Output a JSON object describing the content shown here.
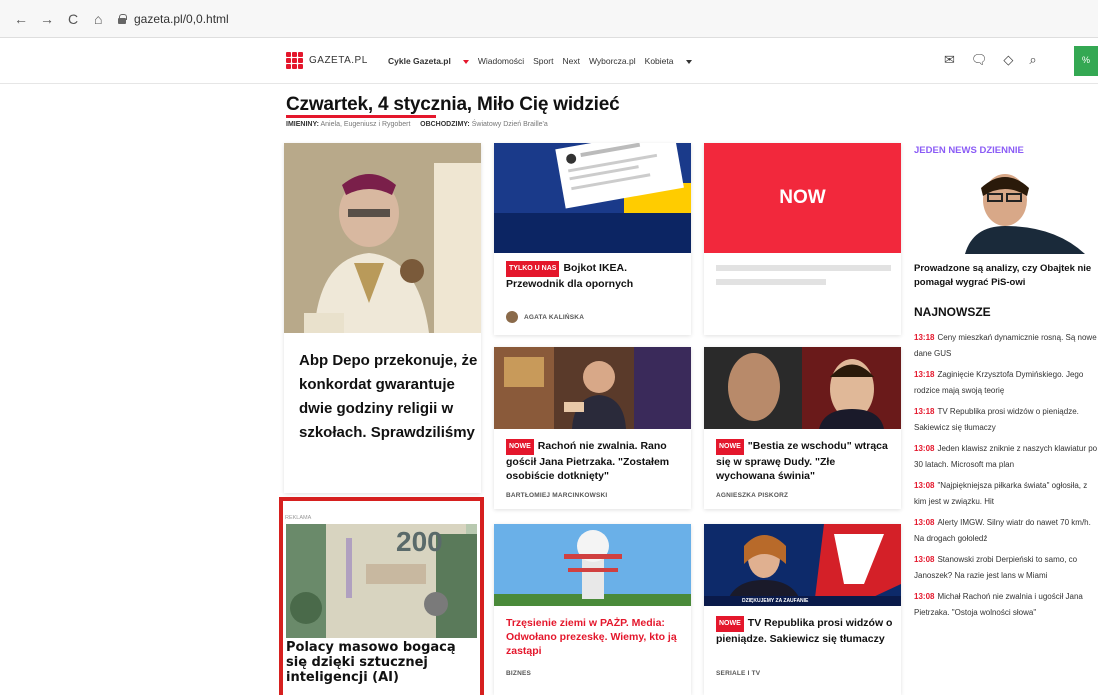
{
  "browser": {
    "back": "←",
    "forward": "→",
    "reload": "C",
    "home": "⌂",
    "url": "gazeta.pl/0,0.html"
  },
  "header": {
    "logo_text": "GAZETA.PL",
    "menu": [
      "Cykle Gazeta.pl",
      "Wiadomości",
      "Sport",
      "Next",
      "Wyborcza.pl",
      "Kobieta"
    ],
    "icons": [
      "mail-icon",
      "chat-icon",
      "tag-icon",
      "search-icon"
    ]
  },
  "greeting": {
    "title": "Czwartek, 4 stycznia, Miło Cię widzieć",
    "namedays_label": "IMIENINY:",
    "namedays": "Aniela, Eugeniusz i Rygobert",
    "celebrate_label": "OBCHODZIMY:",
    "celebrate": "Światowy Dzień Braille'a"
  },
  "cards": {
    "main": {
      "title": "Abp Depo przekonuje, że konkordat gwarantuje dwie godziny religii w szkołach. Sprawdziliśmy"
    },
    "ikea": {
      "tag": "TYLKO U NAS",
      "title": "Bojkot IKEA. Przewodnik dla opornych",
      "author": "AGATA KALIŃSKA"
    },
    "now": {
      "label": "NOW"
    },
    "rachon": {
      "tag": "NOWE",
      "title": "Rachoń nie zwalnia. Rano gościł Jana Pietrzaka. \"Zostałem osobiście dotknięty\"",
      "author": "BARTŁOMIEJ MARCINKOWSKI"
    },
    "bestia": {
      "tag": "NOWE",
      "title": "\"Bestia ze wschodu\" wtrąca się w sprawę Dudy. \"Złe wychowana świnia\"",
      "author": "AGNIESZKA PISKORZ"
    },
    "pazp": {
      "title": "Trzęsienie ziemi w PAŻP. Media: Odwołano prezeskę. Wiemy, kto ją zastąpi",
      "author": "BIZNES"
    },
    "tvrep": {
      "tag": "NOWE",
      "title": "TV Republika prosi widzów o pieniądze. Sakiewicz się tłumaczy",
      "author": "SERIALE I TV",
      "banner": "DZIĘKUJEMY ZA ZAUFANIE"
    }
  },
  "ad": {
    "label": "REKLAMA",
    "banknote_value": "200",
    "title": "Polacy masowo bogacą się dzięki sztucznej inteligencji (AI)"
  },
  "sidebar": {
    "header": "JEDEN NEWS DZIENNIE",
    "featured": "Prowadzone są analizy, czy Obajtek nie pomagał wygrać PiS-owi",
    "latest_header": "NAJNOWSZE",
    "items": [
      {
        "time": "13:18",
        "text": "Ceny mieszkań dynamicznie rosną. Są nowe dane GUS"
      },
      {
        "time": "13:18",
        "text": "Zaginięcie Krzysztofa Dymińskiego. Jego rodzice mają swoją teorię"
      },
      {
        "time": "13:18",
        "text": "TV Republika prosi widzów o pieniądze. Sakiewicz się tłumaczy"
      },
      {
        "time": "13:08",
        "text": "Jeden klawisz zniknie z naszych klawiatur po 30 latach. Microsoft ma plan"
      },
      {
        "time": "13:08",
        "text": "\"Najpiękniejsza piłkarka świata\" ogłosiła, z kim jest w związku. Hit"
      },
      {
        "time": "13:08",
        "text": "Alerty IMGW. Silny wiatr do nawet 70 km/h. Na drogach gołoledź"
      },
      {
        "time": "13:08",
        "text": "Stanowski zrobi Derpieński to samo, co Janoszek? Na razie jest lans w Miami"
      },
      {
        "time": "13:08",
        "text": "Michał Rachoń nie zwalnia i ugościł Jana Pietrzaka. \"Ostoja wolności słowa\""
      }
    ]
  },
  "colors": {
    "accent": "#e4172c",
    "purple": "#8b5cf6",
    "ad_border": "#d6201f",
    "green": "#34a853"
  }
}
